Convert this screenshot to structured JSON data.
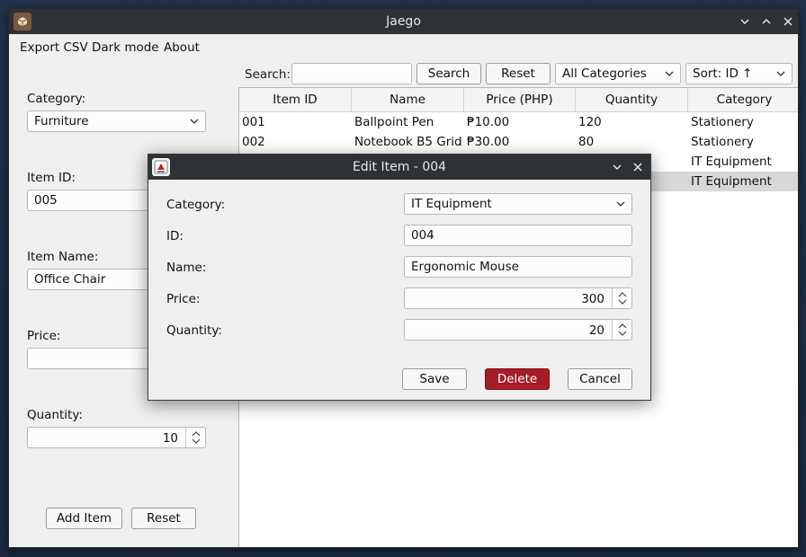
{
  "window": {
    "title": "Jaego"
  },
  "menu": {
    "export_csv": "Export CSV",
    "dark_mode": "Dark mode",
    "about": "About"
  },
  "toolbar": {
    "search_label": "Search:",
    "search_value": "",
    "search_button": "Search",
    "reset_button": "Reset",
    "category_filter": "All Categories",
    "sort": "Sort: ID ↑"
  },
  "form": {
    "category_label": "Category:",
    "category_value": "Furniture",
    "item_id_label": "Item ID:",
    "item_id_value": "005",
    "item_name_label": "Item Name:",
    "item_name_value": "Office Chair",
    "price_label": "Price:",
    "price_value": "",
    "quantity_label": "Quantity:",
    "quantity_value": "10",
    "add_button": "Add Item",
    "reset_button": "Reset"
  },
  "table": {
    "columns": [
      "Item ID",
      "Name",
      "Price (PHP)",
      "Quantity",
      "Category"
    ],
    "rows": [
      {
        "id": "001",
        "name": "Ballpoint Pen",
        "price": "₱10.00",
        "qty": "120",
        "category": "Stationery"
      },
      {
        "id": "002",
        "name": "Notebook B5 Grid",
        "price": "₱30.00",
        "qty": "80",
        "category": "Stationery"
      },
      {
        "id": "",
        "name": "",
        "price": "",
        "qty": "",
        "category": "IT Equipment"
      },
      {
        "id": "",
        "name": "",
        "price": "",
        "qty": "",
        "category": "IT Equipment"
      }
    ]
  },
  "dialog": {
    "title": "Edit Item - 004",
    "category_label": "Category:",
    "category_value": "IT Equipment",
    "id_label": "ID:",
    "id_value": "004",
    "name_label": "Name:",
    "name_value": "Ergonomic Mouse",
    "price_label": "Price:",
    "price_value": "300",
    "quantity_label": "Quantity:",
    "quantity_value": "20",
    "save_button": "Save",
    "delete_button": "Delete",
    "cancel_button": "Cancel"
  },
  "colors": {
    "titlebar": "#2e3136",
    "window_bg": "#efefef",
    "danger": "#a61b25",
    "selected_row": "#d8d8d8"
  }
}
